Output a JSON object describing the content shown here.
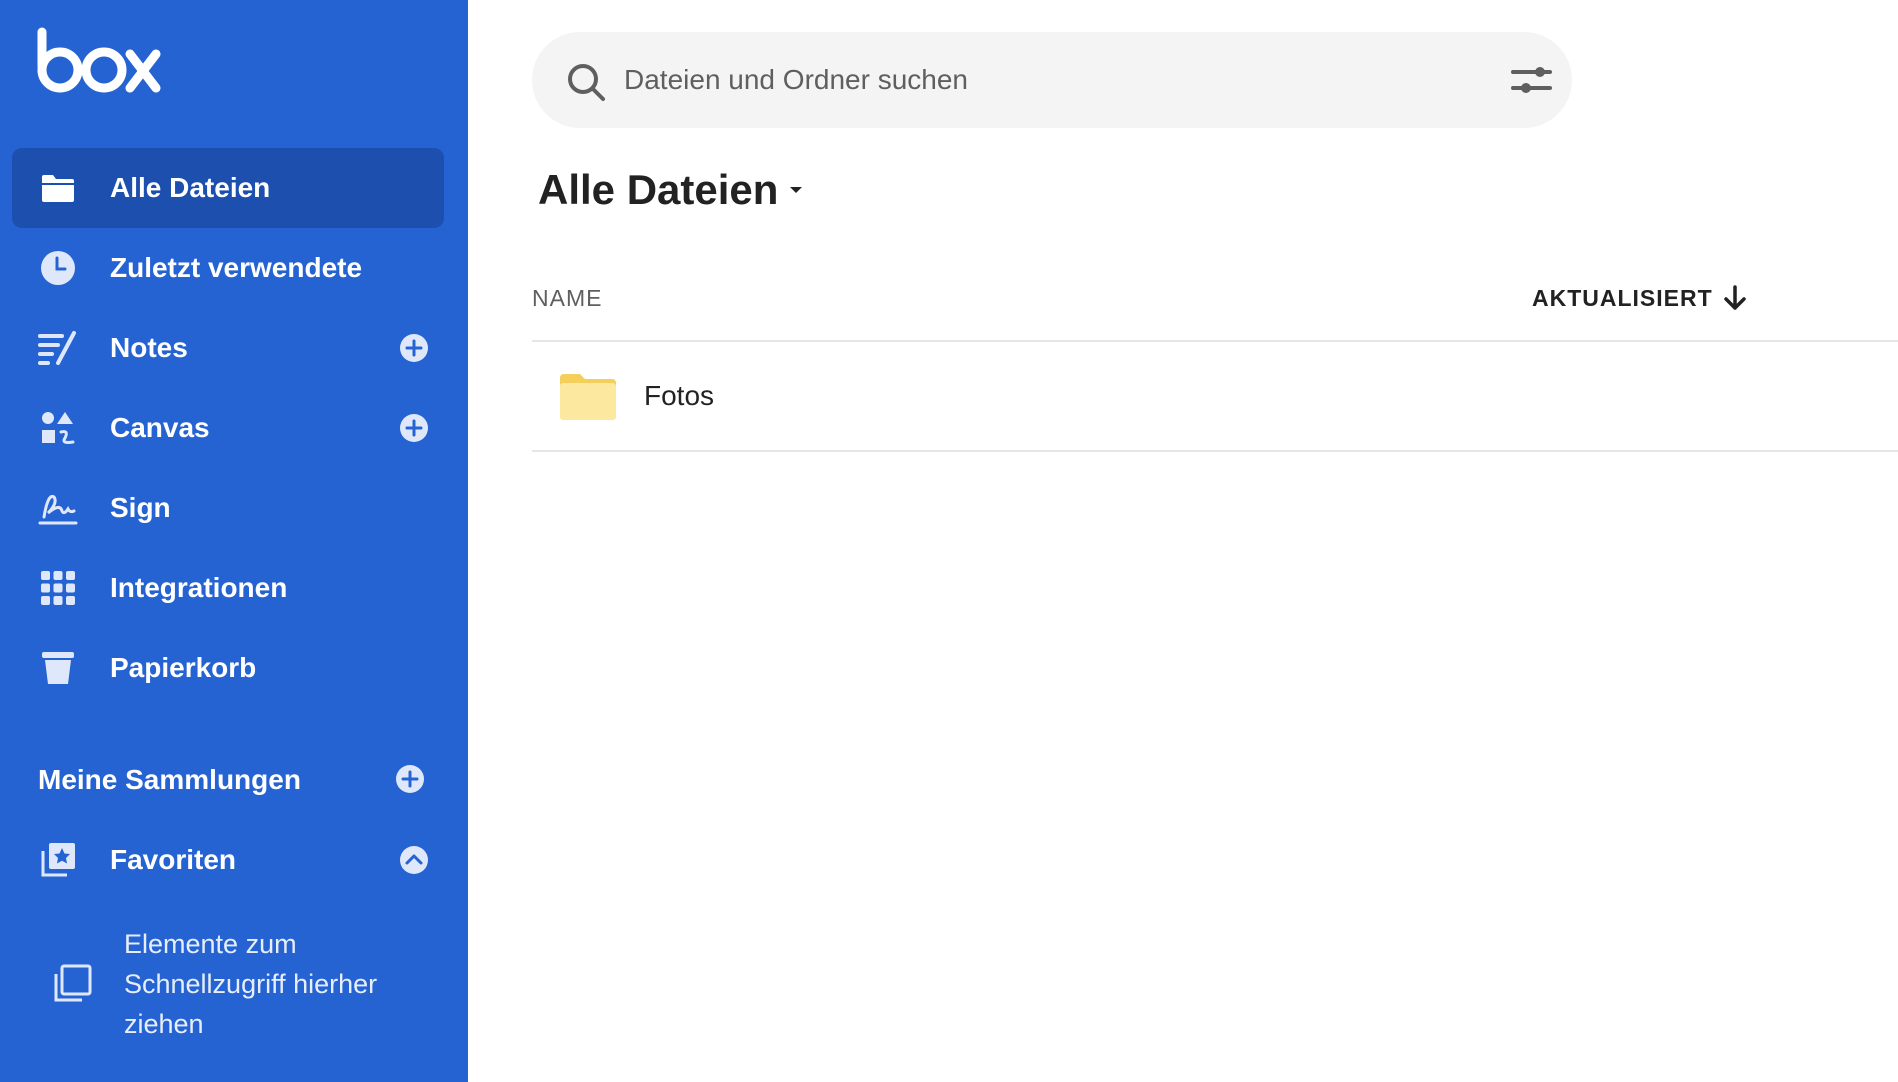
{
  "app": {
    "logo_text": "box",
    "accent_color": "#2563d3",
    "active_color": "#1c4fae"
  },
  "sidebar": {
    "items": [
      {
        "label": "Alle Dateien",
        "icon": "folder-icon",
        "active": true
      },
      {
        "label": "Zuletzt verwendete",
        "icon": "clock-icon"
      },
      {
        "label": "Notes",
        "icon": "notes-icon",
        "has_add": true
      },
      {
        "label": "Canvas",
        "icon": "canvas-icon",
        "has_add": true
      },
      {
        "label": "Sign",
        "icon": "sign-icon"
      },
      {
        "label": "Integrationen",
        "icon": "grid-icon"
      },
      {
        "label": "Papierkorb",
        "icon": "trash-icon"
      }
    ],
    "collections_title": "Meine Sammlungen",
    "favorites_label": "Favoriten",
    "favorites_hint": "Elemente zum Schnellzugriff hierher ziehen"
  },
  "search": {
    "placeholder": "Dateien und Ordner suchen"
  },
  "main": {
    "title": "Alle Dateien",
    "columns": {
      "name": "NAME",
      "updated": "AKTUALISIERT"
    },
    "files": [
      {
        "name": "Fotos",
        "type": "folder"
      }
    ]
  }
}
